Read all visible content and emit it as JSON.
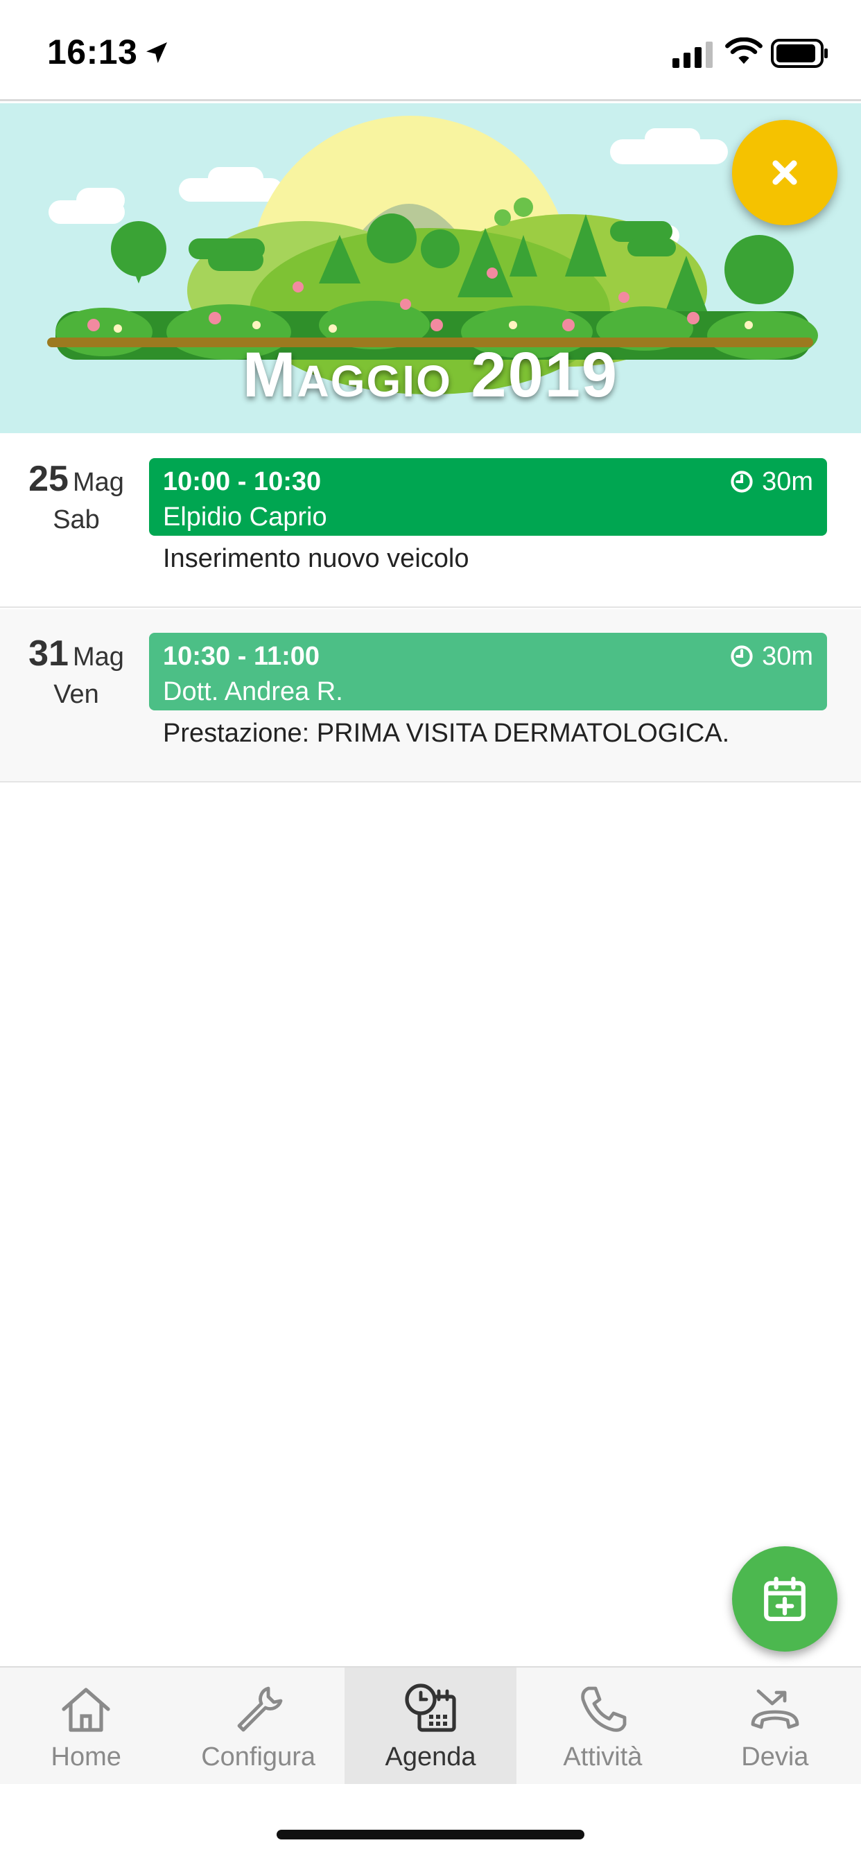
{
  "status_bar": {
    "time": "16:13"
  },
  "banner": {
    "title": "Maggio 2019",
    "bg_color": "#c9f0ee"
  },
  "close_button": {
    "icon": "close-icon",
    "color": "#f5c200"
  },
  "events": [
    {
      "day": "25",
      "month": "Mag",
      "weekday": "Sab",
      "time_range": "10:00 - 10:30",
      "duration": "30m",
      "name": "Elpidio Caprio",
      "description": "Inserimento nuovo veicolo",
      "color": "#00a651"
    },
    {
      "day": "31",
      "month": "Mag",
      "weekday": "Ven",
      "time_range": "10:30 - 11:00",
      "duration": "30m",
      "name": "Dott. Andrea R.",
      "description": "Prestazione: PRIMA VISITA DERMATOLOGICA.",
      "color": "#4cbf86"
    }
  ],
  "add_button": {
    "icon": "calendar-plus-icon",
    "color": "#4cb84f"
  },
  "tabs": [
    {
      "label": "Home",
      "icon": "home-icon",
      "active": false
    },
    {
      "label": "Configura",
      "icon": "wrench-icon",
      "active": false
    },
    {
      "label": "Agenda",
      "icon": "agenda-clock-icon",
      "active": true
    },
    {
      "label": "Attività",
      "icon": "phone-icon",
      "active": false
    },
    {
      "label": "Devia",
      "icon": "call-divert-icon",
      "active": false
    }
  ]
}
